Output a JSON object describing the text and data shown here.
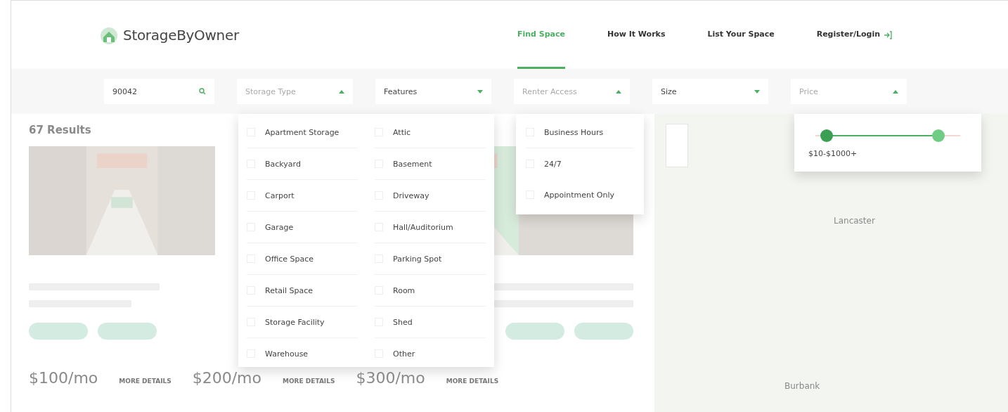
{
  "header": {
    "logo": "StorageByOwner",
    "nav": [
      {
        "label": "Find Space",
        "selected": true
      },
      {
        "label": "How It Works",
        "selected": false
      },
      {
        "label": "List Your Space",
        "selected": false
      },
      {
        "label": "Register/Login",
        "selected": false
      }
    ]
  },
  "filters": {
    "location": {
      "value": "90042"
    },
    "dropdowns": [
      {
        "label": "Storage Type",
        "expanded": true
      },
      {
        "label": "Features",
        "expanded": false
      },
      {
        "label": "Renter Access",
        "expanded": true
      },
      {
        "label": "Size",
        "expanded": false
      },
      {
        "label": "Price",
        "expanded": true
      }
    ]
  },
  "storage_type_menu": {
    "options": [
      {
        "label": "Apartment Storage",
        "checked": false
      },
      {
        "label": "Attic",
        "checked": false
      },
      {
        "label": "Backyard",
        "checked": false
      },
      {
        "label": "Basement",
        "checked": false
      },
      {
        "label": "Carport",
        "checked": false
      },
      {
        "label": "Driveway",
        "checked": false
      },
      {
        "label": "Garage",
        "checked": false
      },
      {
        "label": "Hall/Auditorium",
        "checked": false
      },
      {
        "label": "Office Space",
        "checked": false
      },
      {
        "label": "Parking Spot",
        "checked": false
      },
      {
        "label": "Retail Space",
        "checked": false
      },
      {
        "label": "Room",
        "checked": false
      },
      {
        "label": "Storage Facility",
        "checked": false
      },
      {
        "label": "Shed",
        "checked": false
      },
      {
        "label": "Warehouse",
        "checked": false
      },
      {
        "label": "Other",
        "checked": false
      }
    ]
  },
  "renter_access_menu": {
    "options": [
      {
        "label": "Business Hours",
        "checked": false
      },
      {
        "label": "24/7",
        "checked": false
      },
      {
        "label": "Appointment Only",
        "checked": false
      }
    ]
  },
  "price_menu": {
    "thumbs": [
      {
        "level": 0.08
      },
      {
        "level": 0.85
      }
    ],
    "reading": "$10-$1000+"
  },
  "results": {
    "count": "67 Results",
    "items": [
      {
        "price": "$100/mo",
        "details_link": "MORE DETAILS"
      },
      {
        "price": "$200/mo",
        "details_link": "MORE DETAILS"
      },
      {
        "price": "$300/mo",
        "details_link": "MORE DETAILS"
      }
    ]
  },
  "map": {
    "places": [
      "Lancaster",
      "Burbank"
    ]
  }
}
